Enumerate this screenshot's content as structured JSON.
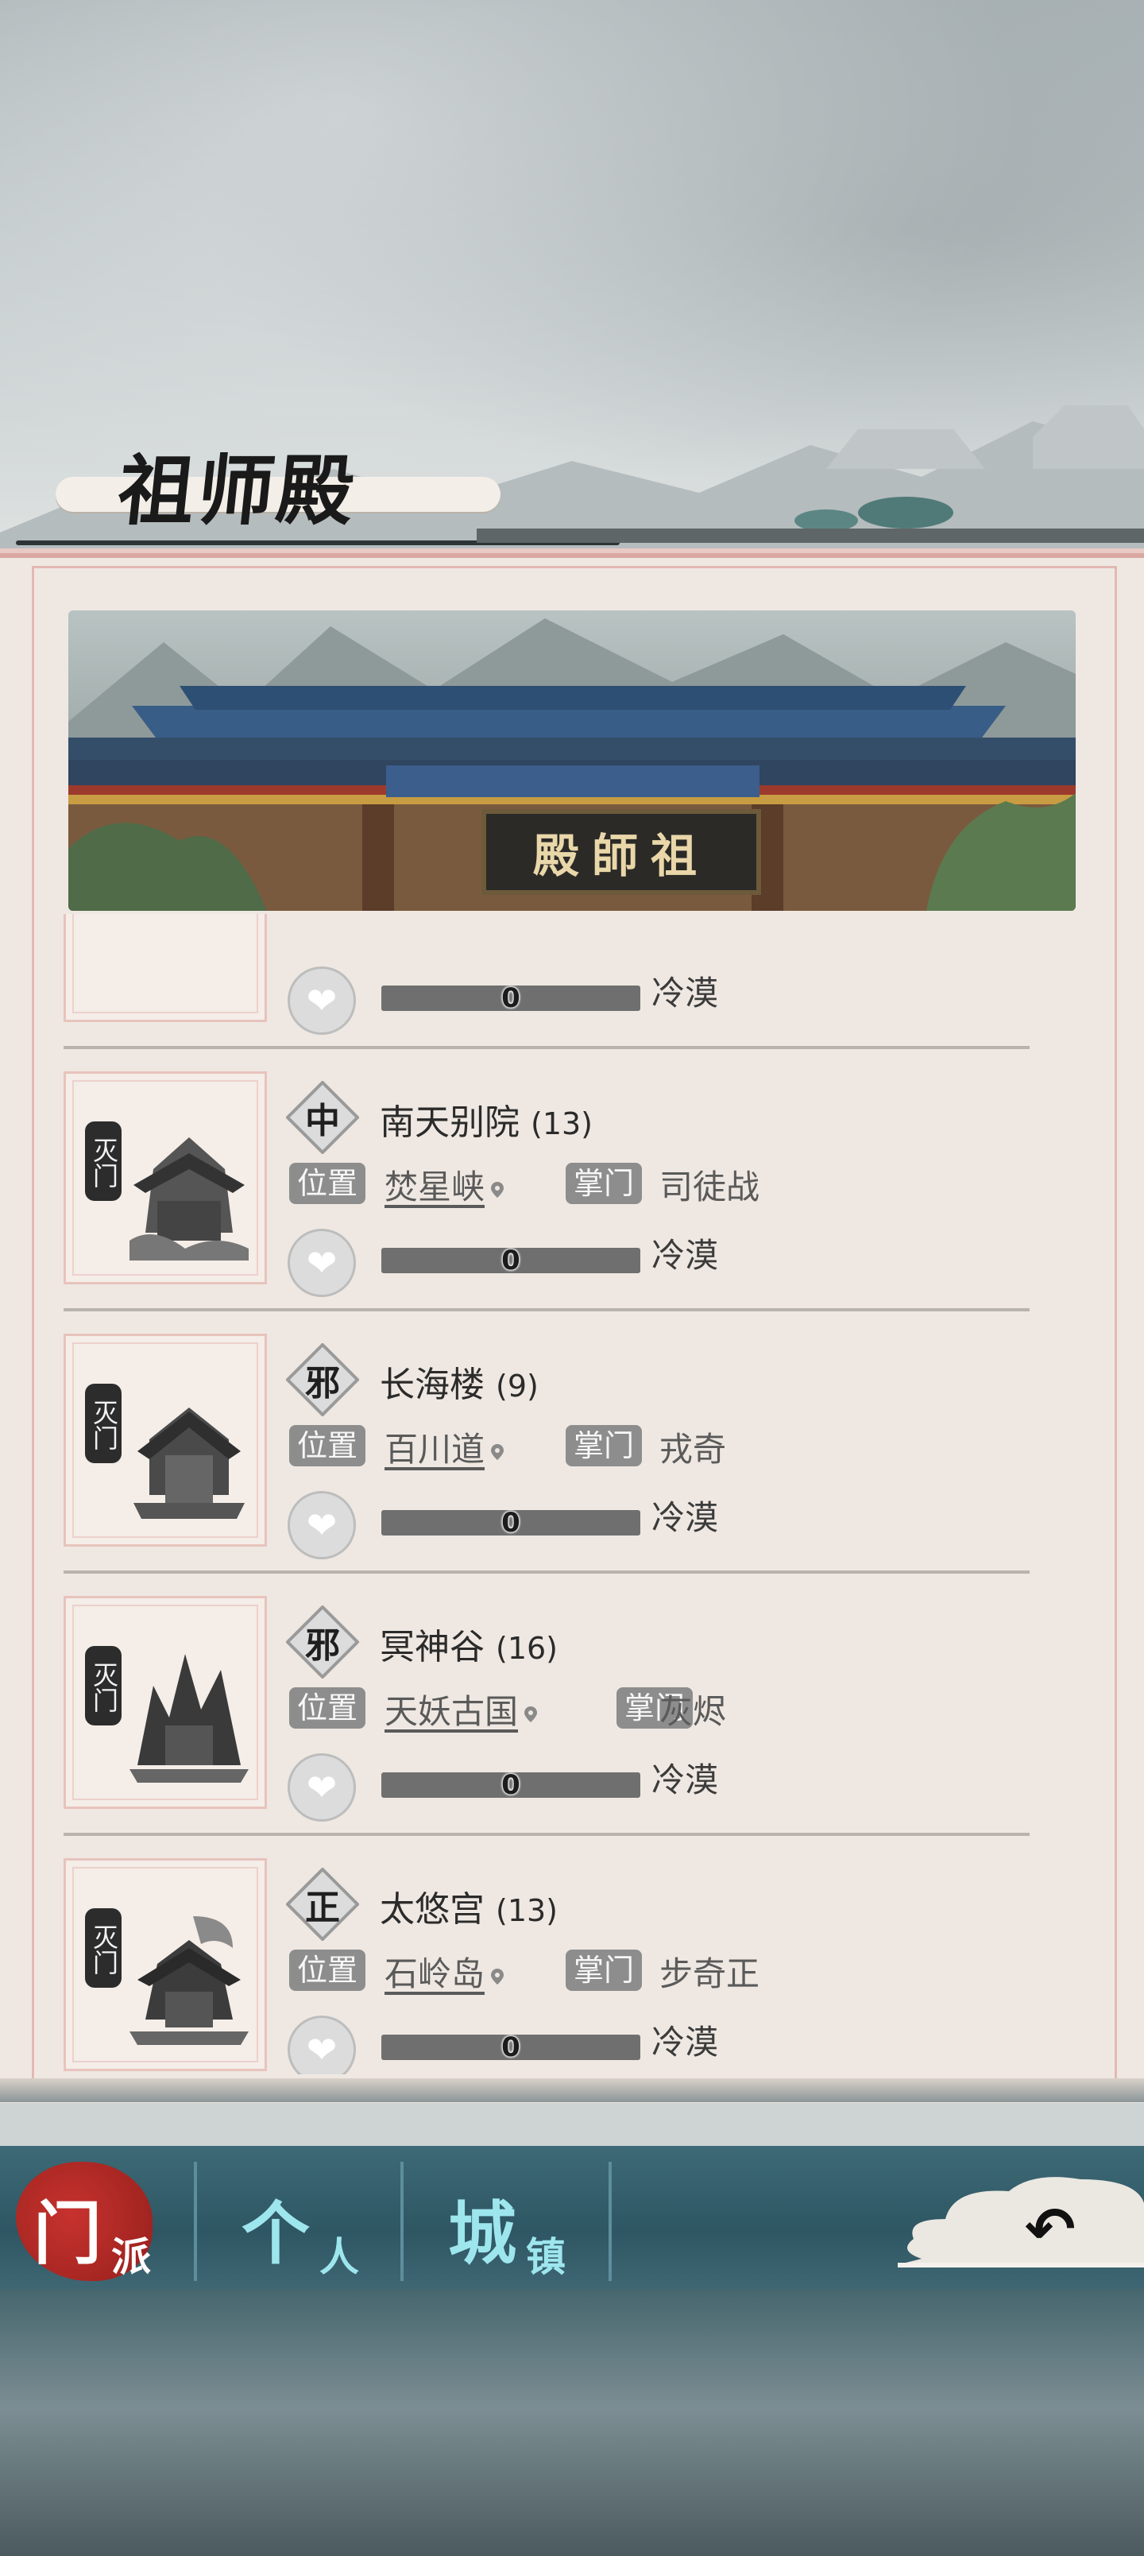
{
  "title": "祖师殿",
  "hero": {
    "plaque": "殿師祖"
  },
  "labels": {
    "tag": "灭门",
    "location": "位置",
    "master": "掌门"
  },
  "partial_row": {
    "progress": 0,
    "progress_text": "0",
    "attitude": "冷漠"
  },
  "sects": [
    {
      "badge": "中",
      "name": "南天别院",
      "count": "(13)",
      "location": "焚星峡",
      "master": "司徒战",
      "progress": 0,
      "progress_text": "0",
      "attitude": "冷漠"
    },
    {
      "badge": "邪",
      "name": "长海楼",
      "count": "(9)",
      "location": "百川道",
      "master": "戎奇",
      "progress": 0,
      "progress_text": "0",
      "attitude": "冷漠"
    },
    {
      "badge": "邪",
      "name": "冥神谷",
      "count": "(16)",
      "location": "天妖古国",
      "master": "灰烬",
      "progress": 0,
      "progress_text": "0",
      "attitude": "冷漠"
    },
    {
      "badge": "正",
      "name": "太悠宫",
      "count": "(13)",
      "location": "石岭岛",
      "master": "步奇正",
      "progress": 0,
      "progress_text": "0",
      "attitude": "冷漠"
    }
  ],
  "nav": {
    "tabs": [
      {
        "big": "门",
        "small": "派"
      },
      {
        "big": "个",
        "small": "人"
      },
      {
        "big": "城",
        "small": "镇"
      }
    ],
    "active": "门派"
  },
  "icons": {
    "back": "back-arrow-icon",
    "heart": "heart-icon",
    "pin": "location-pin-icon"
  },
  "colors": {
    "accent": "#c7322e",
    "nav": "#2e5663",
    "tab_text": "#9ee6ee"
  }
}
